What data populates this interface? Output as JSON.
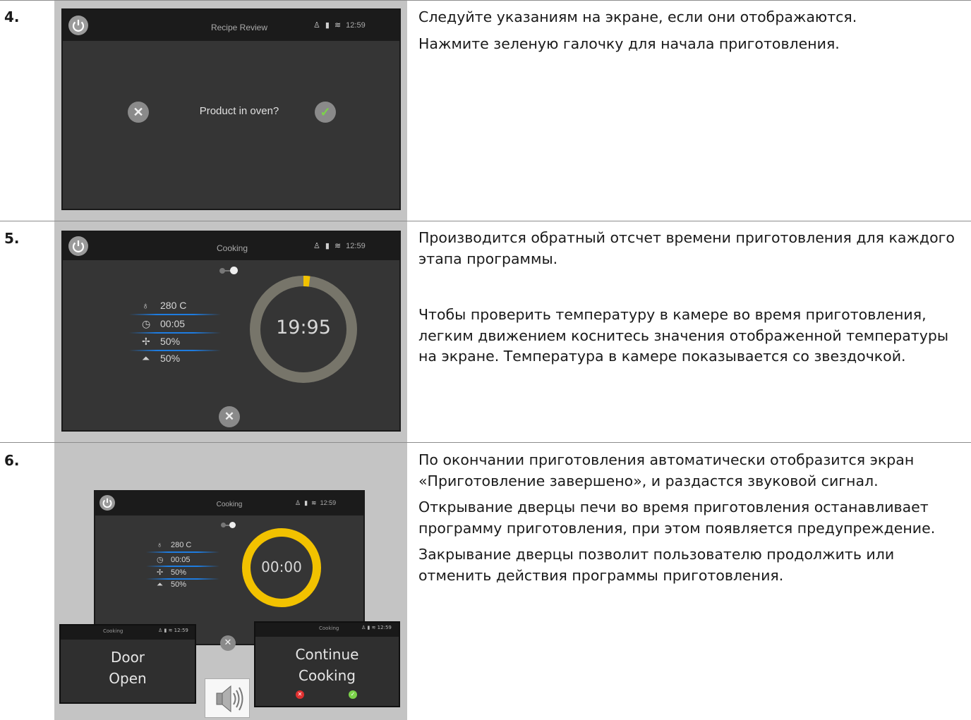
{
  "steps": [
    {
      "number": "4.",
      "paragraphs": [
        "Следуйте указаниям на экране, если они отображаются.",
        "Нажмите зеленую галочку для начала приготовления."
      ],
      "screen": {
        "title": "Recipe Review",
        "clock": "12:59",
        "prompt": "Product in oven?",
        "cancel_icon": "x-icon",
        "confirm_icon": "check-icon"
      }
    },
    {
      "number": "5.",
      "paragraphs": [
        "Производится обратный отсчет времени приготовления для каждого этапа программы.",
        "Чтобы проверить температуру в камере во время приготовления, легким движением коснитесь значения отображенной температуры на экране. Температура в камере показывается со звездочкой."
      ],
      "screen": {
        "title": "Cooking",
        "clock": "12:59",
        "params": [
          "280 C",
          "00:05",
          "50%",
          "50%"
        ],
        "timer": "19:95",
        "ring_progress": 0.02
      }
    },
    {
      "number": "6.",
      "paragraphs": [
        "По окончании приготовления автоматически отобразится экран «Приготовление завершено», и раздастся звуковой сигнал.",
        "Открывание дверцы печи во время приготовления останавливает программу приготовления, при этом появляется предупреждение.",
        "Закрывание дверцы позволит пользователю продолжить или отменить действия программы приготовления."
      ],
      "screen": {
        "title": "Cooking",
        "clock": "12:59",
        "params": [
          "280 C",
          "00:05",
          "50%",
          "50%"
        ],
        "timer": "00:00",
        "ring_progress": 1.0
      },
      "popup_door": {
        "title": "Cooking",
        "clock": "12:59",
        "line1": "Door",
        "line2": "Open"
      },
      "popup_continue": {
        "title": "Cooking",
        "clock": "12:59",
        "line1": "Continue",
        "line2": "Cooking"
      }
    }
  ],
  "colors": {
    "screen_bg": "#353535",
    "topbar": "#1b1b1b",
    "accent_yellow": "#f2c200",
    "ring_gray": "#77756a",
    "param_underline": "#1e7ce0",
    "confirm_green": "#7bd24a",
    "cancel_red": "#e03030"
  }
}
